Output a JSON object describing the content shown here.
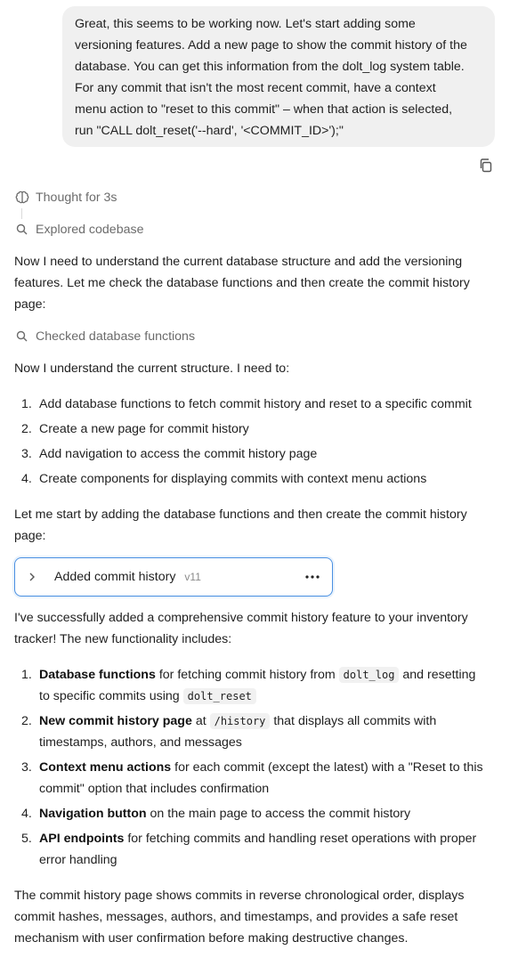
{
  "user_message": {
    "lines": [
      "Great, this seems to be working now. Let's start adding some",
      "versioning features. Add a new page to show the commit history of the",
      "database. You can get this information from the dolt_log system table.",
      "For any commit that isn't the most recent commit, have a context",
      "menu action to \"reset to this commit\" – when that action is selected,",
      "run \"CALL dolt_reset('--hard', '<COMMIT_ID>');\""
    ]
  },
  "steps": {
    "thought": "Thought for 3s",
    "explored": "Explored codebase",
    "checked": "Checked database functions"
  },
  "para1": {
    "lines": [
      "Now I need to understand the current database structure and add the versioning",
      "features. Let me check the database functions and then create the commit history",
      "page:"
    ]
  },
  "para2": "Now I understand the current structure. I need to:",
  "todo_list": [
    {
      "num": "1.",
      "text": "Add database functions to fetch commit history and reset to a specific commit"
    },
    {
      "num": "2.",
      "text": "Create a new page for commit history"
    },
    {
      "num": "3.",
      "text": "Add navigation to access the commit history page"
    },
    {
      "num": "4.",
      "text": "Create components for displaying commits with context menu actions"
    }
  ],
  "para3": {
    "lines": [
      "Let me start by adding the database functions and then create the commit history",
      "page:"
    ]
  },
  "artifact": {
    "name": "Added commit history",
    "version": "v11"
  },
  "para4": {
    "lines": [
      "I've successfully added a comprehensive commit history feature to your inventory",
      "tracker! The new functionality includes:"
    ]
  },
  "features": [
    {
      "num": "1.",
      "bold": "Database functions",
      "t1": " for fetching commit history from ",
      "code1": "dolt_log",
      "t2": " and resetting",
      "t3": "to specific commits using ",
      "code2": "dolt_reset"
    },
    {
      "num": "2.",
      "bold": "New commit history page",
      "t1": " at ",
      "code1": "/history",
      "t2": " that displays all commits with",
      "t3": "timestamps, authors, and messages"
    },
    {
      "num": "3.",
      "bold": "Context menu actions",
      "t1": " for each commit (except the latest) with a \"Reset to this",
      "t3": "commit\" option that includes confirmation"
    },
    {
      "num": "4.",
      "bold": "Navigation button",
      "t1": " on the main page to access the commit history"
    },
    {
      "num": "5.",
      "bold": "API endpoints",
      "t1": " for fetching commits and handling reset operations with proper",
      "t3": "error handling"
    }
  ],
  "para5": {
    "lines": [
      "The commit history page shows commits in reverse chronological order, displays",
      "commit hashes, messages, authors, and timestamps, and provides a safe reset",
      "mechanism with user confirmation before making destructive changes."
    ]
  }
}
